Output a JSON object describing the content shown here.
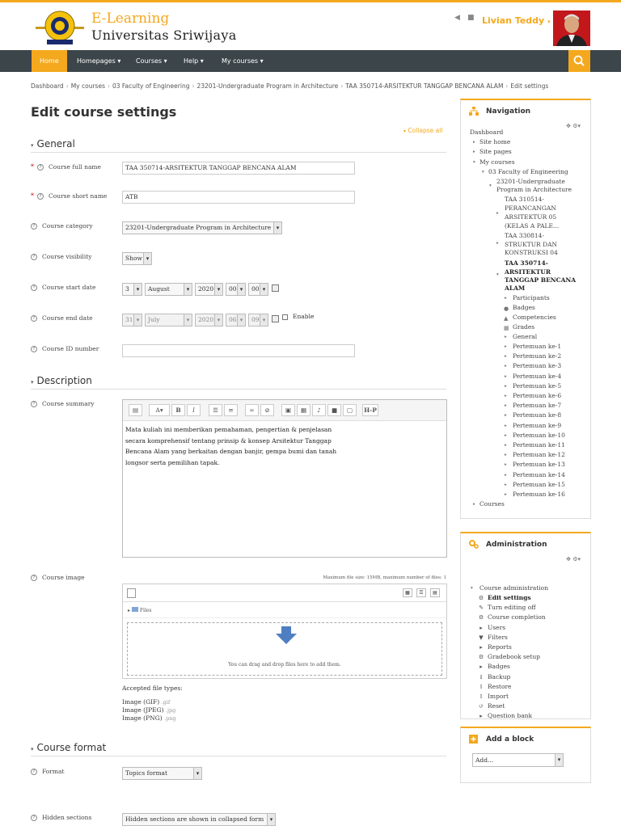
{
  "brand": {
    "line1": "E-Learning",
    "line2": "Universitas  Sriwijaya",
    "accent": "#f4a81d",
    "navbar": "#3c4549"
  },
  "user": {
    "name": "Livian Teddy"
  },
  "nav": {
    "home": "Home",
    "homepages": "Homepages",
    "courses": "Courses",
    "help": "Help",
    "mycourses": "My courses"
  },
  "breadcrumb": [
    "Dashboard",
    "My courses",
    "03 Faculty of Engineering",
    "23201-Undergraduate Program in Architecture",
    "TAA 350714-ARSITEKTUR TANGGAP BENCANA ALAM",
    "Edit settings"
  ],
  "page": {
    "title": "Edit course settings",
    "collapse_all": "Collapse all"
  },
  "general": {
    "heading": "General",
    "full_name_label": "Course full name",
    "full_name_value": "TAA 350714-ARSITEKTUR TANGGAP BENCANA ALAM",
    "short_name_label": "Course short name",
    "short_name_value": "ATB",
    "category_label": "Course category",
    "category_value": "23201-Undergraduate Program in Architecture",
    "visibility_label": "Course visibility",
    "visibility_value": "Show",
    "start_label": "Course start date",
    "start": {
      "day": "3",
      "month": "August",
      "year": "2020",
      "hour": "00",
      "minute": "00"
    },
    "end_label": "Course end date",
    "end": {
      "day": "31",
      "month": "July",
      "year": "2020",
      "hour": "06",
      "minute": "09"
    },
    "enable_label": "Enable",
    "id_label": "Course ID number",
    "id_value": ""
  },
  "description": {
    "heading": "Description",
    "summary_label": "Course summary",
    "toolbar_hp": "H-P",
    "summary_lines": [
      "Mata kuliah ini memberikan pemahaman,  pengertian & penjelasan",
      "secara komprehensif tentang prinsip & konsep  Arsitektur Tanggap",
      "Bencana Alam yang berkaitan dengan banjir, gempa bumi dan tanah",
      "longsor serta pemilihan tapak."
    ],
    "image_label": "Course image",
    "max_size": "Maximum file size: 15MB, maximum number of files: 1",
    "files_label": "Files",
    "drop_text": "You can drag and drop files here to add them.",
    "accepted_title": "Accepted file types:",
    "accepted": [
      {
        "name": "Image (GIF)",
        "ext": ".gif"
      },
      {
        "name": "Image (JPEG)",
        "ext": ".jpg"
      },
      {
        "name": "Image (PNG)",
        "ext": ".png"
      }
    ]
  },
  "format": {
    "heading": "Course format",
    "format_label": "Format",
    "format_value": "Topics format",
    "hidden_label": "Hidden sections",
    "hidden_value": "Hidden sections are shown in collapsed form"
  },
  "navigation_block": {
    "title": "Navigation",
    "dashboard": "Dashboard",
    "site_home": "Site home",
    "site_pages": "Site pages",
    "my_courses": "My courses",
    "faculty": "03 Faculty of Engineering",
    "program": [
      "23201-Undergraduate",
      "Program in Architecture"
    ],
    "c1": [
      "TAA 310514-",
      "PERANCANGAN",
      "ARSITEKTUR 05",
      "(KELAS A PALE..."
    ],
    "c2": [
      "TAA 330814-",
      "STRUKTUR DAN",
      "KONSTRUKSI 04"
    ],
    "c3": [
      "TAA 350714-",
      "ARSITEKTUR",
      "TANGGAP BENCANA",
      "ALAM"
    ],
    "course_items": [
      "Participants",
      "Badges",
      "Competencies",
      "Grades",
      "General"
    ],
    "meetings": [
      "Pertemuan ke-1",
      "Pertemuan ke-2",
      "Pertemuan ke-3",
      "Pertemuan ke-4",
      "Pertemuan ke-5",
      "Pertemuan ke-6",
      "Pertemuan ke-7",
      "Pertemuan ke-8",
      "Pertemuan ke-9",
      "Pertemuan ke-10",
      "Pertemuan ke-11",
      "Pertemuan ke-12",
      "Pertemuan ke-13",
      "Pertemuan ke-14",
      "Pertemuan ke-15",
      "Pertemuan ke-16"
    ],
    "courses": "Courses"
  },
  "admin_block": {
    "title": "Administration",
    "course_admin": "Course administration",
    "items": [
      "Edit settings",
      "Turn editing off",
      "Course completion",
      "Users",
      "Filters",
      "Reports",
      "Gradebook setup",
      "Badges",
      "Backup",
      "Restore",
      "Import",
      "Reset",
      "Question bank"
    ]
  },
  "add_block": {
    "title": "Add a block",
    "select_value": "Add..."
  }
}
